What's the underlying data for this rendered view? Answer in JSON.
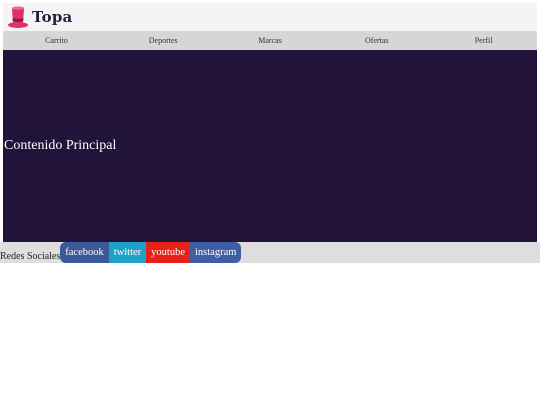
{
  "header": {
    "brand": "Topa",
    "logo_icon": "top-hat-icon",
    "colors": {
      "hat": "#e2306c",
      "hat_band": "#8a1b45",
      "brand_text": "#2b1c3d"
    }
  },
  "nav": {
    "items": [
      {
        "label": "Carrito"
      },
      {
        "label": "Deportes"
      },
      {
        "label": "Marcas"
      },
      {
        "label": "Ofertas"
      },
      {
        "label": "Perfil"
      }
    ]
  },
  "main": {
    "title": "Contenido Principal",
    "background": "#22133a"
  },
  "footer": {
    "label": "Redes Sociales",
    "social": [
      {
        "label": "facebook",
        "color": "#3b5998"
      },
      {
        "label": "twitter",
        "color": "#1da1c6"
      },
      {
        "label": "youtube",
        "color": "#e62117"
      },
      {
        "label": "instagram",
        "color": "#3f5ea3"
      }
    ]
  }
}
